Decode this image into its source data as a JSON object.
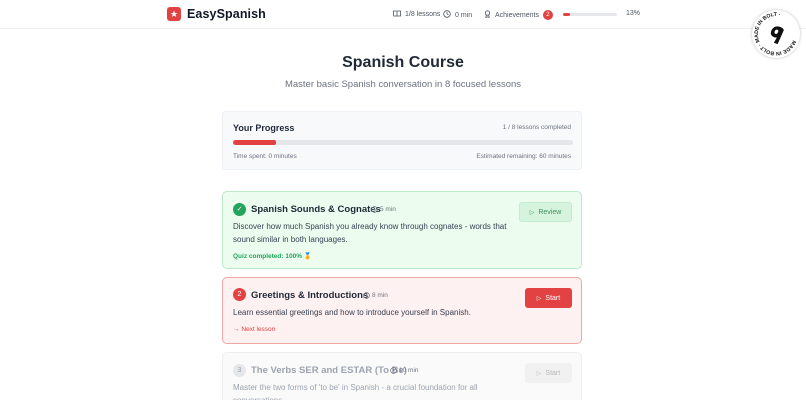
{
  "app": {
    "name": "EasySpanish",
    "brand_color": "#e24242"
  },
  "header": {
    "lessons_stat": "1/8 lessons",
    "time_stat": "0 min",
    "achievements_label": "Achievements",
    "achievements_count": "2",
    "progress_fraction": 0.13,
    "progress_pct": "13%"
  },
  "stamp": {
    "text": "MADE IN BOLT · MADE IN BOLT · "
  },
  "page": {
    "title": "Spanish Course",
    "subtitle": "Master basic Spanish conversation in 8 focused lessons"
  },
  "progress_card": {
    "title": "Your Progress",
    "count": "1 / 8 lessons completed",
    "fraction": 0.125,
    "time_spent": "Time spent: 0 minutes",
    "remaining": "Estimated remaining: 60 minutes"
  },
  "lessons": [
    {
      "number": "✓",
      "status": "completed",
      "title": "Spanish Sounds & Cognates",
      "duration": "5 min",
      "description": "Discover how much Spanish you already know through cognates - words that sound similar in both languages.",
      "button": "Review",
      "note": "Quiz completed: 100%",
      "note_icon": "🏅"
    },
    {
      "number": "2",
      "status": "next",
      "title": "Greetings & Introductions",
      "duration": "8 min",
      "description": "Learn essential greetings and how to introduce yourself in Spanish.",
      "button": "Start",
      "note": "Next lesson"
    },
    {
      "number": "3",
      "status": "locked",
      "title": "The Verbs SER and ESTAR (To Be)",
      "duration": "10 min",
      "description": "Master the two forms of 'to be' in Spanish - a crucial foundation for all conversations.",
      "button": "Start"
    }
  ],
  "icons": {
    "logo": "star-icon",
    "lessons": "book-icon",
    "time": "clock-icon",
    "achievements": "award-icon",
    "play": "play-icon",
    "arrow": "arrow-right-icon"
  }
}
